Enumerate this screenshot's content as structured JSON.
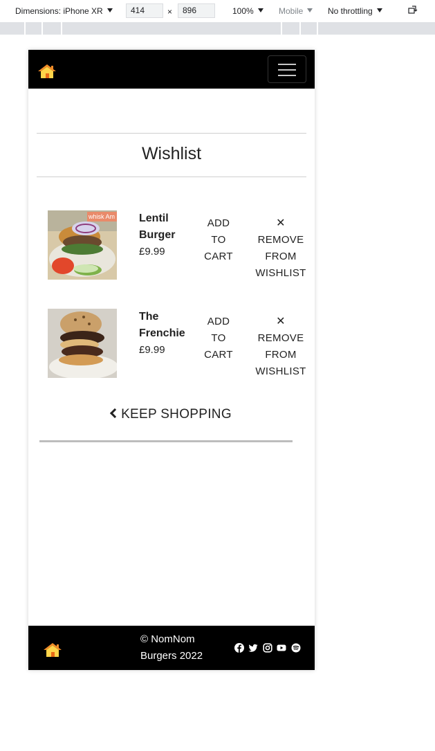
{
  "devtools": {
    "dimensions_label": "Dimensions: iPhone XR",
    "width": "414",
    "times": "×",
    "height": "896",
    "zoom": "100%",
    "mode": "Mobile",
    "throttling": "No throttling",
    "icons": [
      "caret-down-icon",
      "rotate-icon"
    ]
  },
  "navbar": {
    "logo_icon": "home-icon",
    "toggler_icon": "hamburger-menu-icon"
  },
  "page": {
    "title": "Wishlist"
  },
  "wishlist": {
    "items": [
      {
        "name_line1": "Lentil",
        "name_line2": "Burger",
        "price": "£9.99",
        "add_to_cart": [
          "ADD",
          "TO",
          "CART"
        ],
        "remove_icon": "✕",
        "remove": [
          "REMOVE",
          "FROM",
          "WISHLIST"
        ],
        "image_text": "whisk Am"
      },
      {
        "name_line1": "The",
        "name_line2": "Frenchie",
        "price": "£9.99",
        "add_to_cart": [
          "ADD",
          "TO",
          "CART"
        ],
        "remove_icon": "✕",
        "remove": [
          "REMOVE",
          "FROM",
          "WISHLIST"
        ]
      }
    ],
    "keep_shopping": "KEEP SHOPPING"
  },
  "footer": {
    "copyright_line1": "© NomNom",
    "copyright_line2": "Burgers 2022",
    "social_icons": [
      "facebook-icon",
      "twitter-icon",
      "instagram-icon",
      "youtube-icon",
      "spotify-icon"
    ]
  },
  "colors": {
    "navbar_bg": "#000000",
    "logo_roof": "#f28c28",
    "logo_body": "#ffd54a"
  }
}
